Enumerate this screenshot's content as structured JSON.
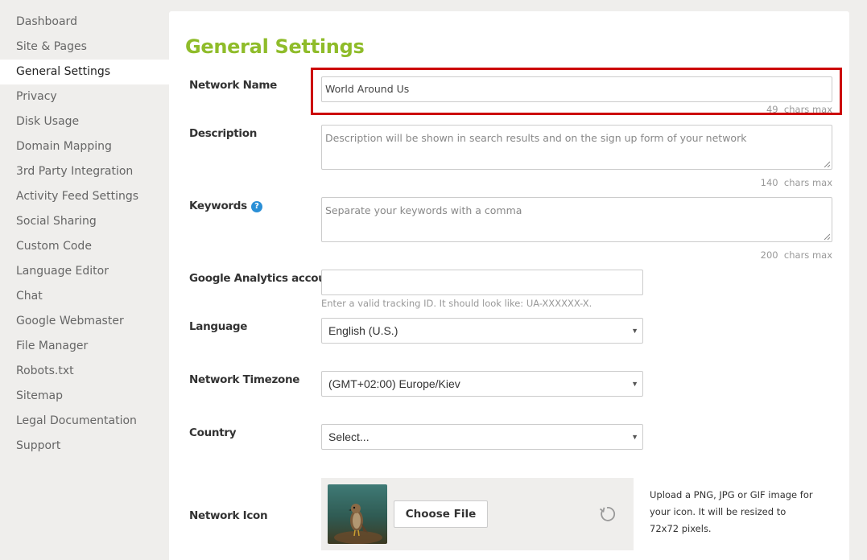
{
  "sidebar": {
    "items": [
      {
        "label": "Dashboard"
      },
      {
        "label": "Site & Pages"
      },
      {
        "label": "General Settings",
        "active": true
      },
      {
        "label": "Privacy"
      },
      {
        "label": "Disk Usage"
      },
      {
        "label": "Domain Mapping"
      },
      {
        "label": "3rd Party Integration"
      },
      {
        "label": "Activity Feed Settings"
      },
      {
        "label": "Social Sharing"
      },
      {
        "label": "Custom Code"
      },
      {
        "label": "Language Editor"
      },
      {
        "label": "Chat"
      },
      {
        "label": "Google Webmaster"
      },
      {
        "label": "File Manager"
      },
      {
        "label": "Robots.txt"
      },
      {
        "label": "Sitemap"
      },
      {
        "label": "Legal Documentation"
      },
      {
        "label": "Support"
      }
    ]
  },
  "main": {
    "title": "General Settings",
    "network_name": {
      "label": "Network Name",
      "value": "World Around Us",
      "counter_num": "49",
      "counter_unit": "chars max"
    },
    "description": {
      "label": "Description",
      "placeholder": "Description will be shown in search results and on the sign up form of your network",
      "counter_num": "140",
      "counter_unit": "chars max"
    },
    "keywords": {
      "label": "Keywords",
      "help_icon": "question-circle-icon",
      "help_glyph": "?",
      "placeholder": "Separate your keywords with a comma",
      "counter_num": "200",
      "counter_unit": "chars max"
    },
    "analytics": {
      "label": "Google Analytics account",
      "value": "",
      "hint": "Enter a valid tracking ID. It should look like: UA-XXXXXX-X."
    },
    "language": {
      "label": "Language",
      "selected": "English (U.S.)"
    },
    "timezone": {
      "label": "Network Timezone",
      "selected": "(GMT+02:00) Europe/Kiev"
    },
    "country": {
      "label": "Country",
      "selected": "Select..."
    },
    "network_icon": {
      "label": "Network Icon",
      "choose_label": "Choose File",
      "help_text": "Upload a PNG, JPG or GIF image for your icon. It will be resized to 72x72 pixels."
    }
  },
  "colors": {
    "accent_green": "#8fbc2a",
    "highlight_red": "#cc0000",
    "help_blue": "#2a8fd6"
  }
}
